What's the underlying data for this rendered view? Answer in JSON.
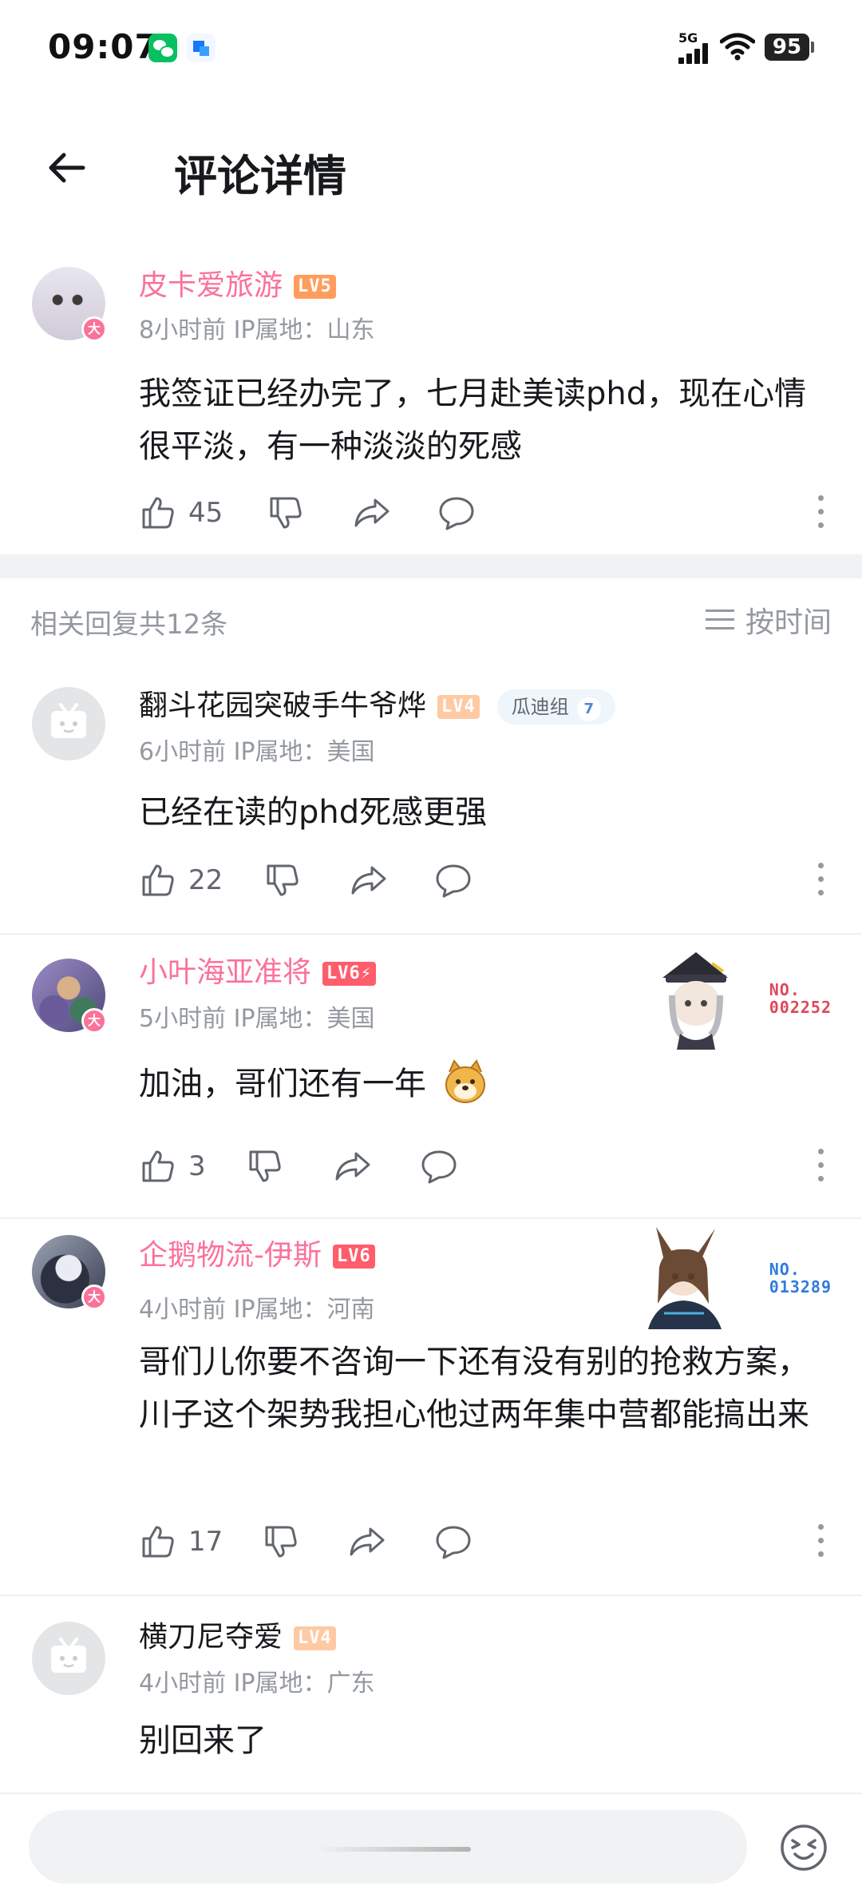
{
  "status_bar": {
    "time": "09:07",
    "network": "5G",
    "battery": "95"
  },
  "header": {
    "title": "评论详情"
  },
  "main_comment": {
    "username": "皮卡爱旅游",
    "level": "LV5",
    "meta": "8小时前 IP属地：山东",
    "content": "我签证已经办完了，七月赴美读phd，现在心情很平淡，有一种淡淡的死感",
    "likes": "45"
  },
  "replies_header": {
    "count_text": "相关回复共12条",
    "sort_label": "按时间"
  },
  "replies": [
    {
      "username": "翻斗花园突破手牛爷烨",
      "level": "LV4",
      "fan_group": "瓜迪组",
      "fan_level": "7",
      "meta": "6小时前 IP属地：美国",
      "content": "已经在读的phd死感更强",
      "likes": "22"
    },
    {
      "username": "小叶海亚准将",
      "level": "LV6⚡",
      "decoration_no": [
        "NO.",
        "002252"
      ],
      "meta": "5小时前 IP属地：美国",
      "content": "加油，哥们还有一年",
      "likes": "3"
    },
    {
      "username": "企鹅物流-伊斯",
      "level": "LV6",
      "decoration_no": [
        "NO.",
        "013289"
      ],
      "meta": "4小时前 IP属地：河南",
      "content": "哥们儿你要不咨询一下还有没有别的抢救方案，川子这个架势我担心他过两年集中营都能搞出来",
      "likes": "17"
    },
    {
      "username": "横刀尼夺爱",
      "level": "LV4",
      "meta": "4小时前 IP属地：广东",
      "content": "别回来了"
    }
  ],
  "avatar_badge": "大",
  "colors": {
    "vip_pink": "#fb7299",
    "text_gray": "#9499a0",
    "deco_red": "#e0475a",
    "deco_blue": "#2f7be0"
  },
  "icons": [
    "back-arrow-icon",
    "like-icon",
    "dislike-icon",
    "share-icon",
    "reply-icon",
    "more-icon",
    "sort-icon",
    "emoji-icon"
  ]
}
